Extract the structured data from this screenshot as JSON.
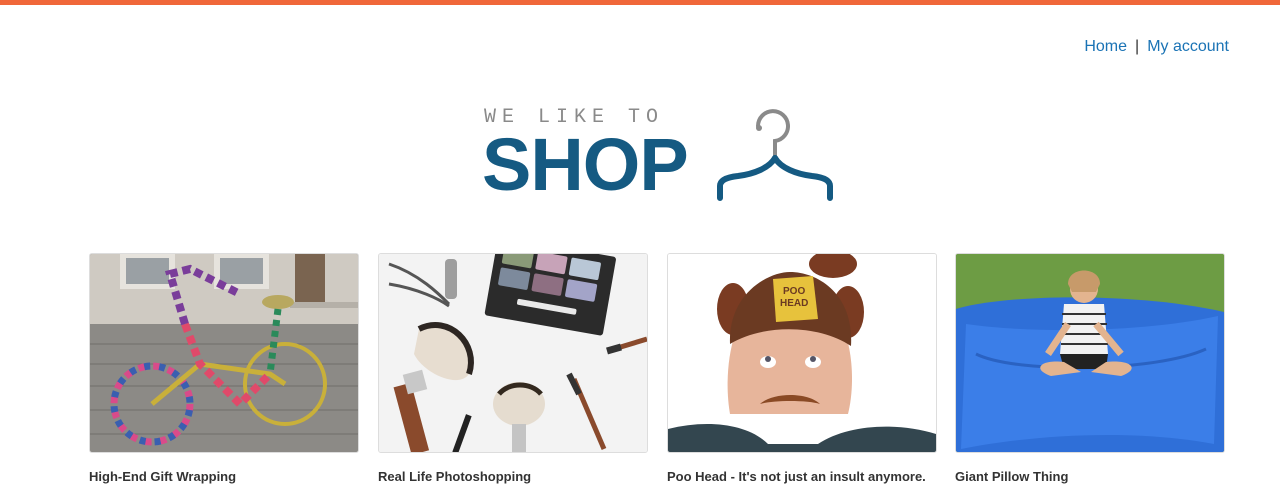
{
  "header": {
    "accent_color": "#f0673a",
    "nav": {
      "home_label": "Home",
      "separator": "|",
      "account_label": "My account",
      "link_color": "#1a73b5"
    }
  },
  "logo": {
    "tagline": "WE LIKE TO",
    "word": "SHOP",
    "icon": "hanger-icon",
    "color": "#155a82"
  },
  "products": [
    {
      "title": "High-End Gift Wrapping",
      "image": "knitted-bicycle-image"
    },
    {
      "title": "Real Life Photoshopping",
      "image": "makeup-brushes-image"
    },
    {
      "title": "Poo Head - It's not just an insult anymore.",
      "image": "poo-head-hat-image"
    },
    {
      "title": "Giant Pillow Thing",
      "image": "giant-pillow-image"
    }
  ]
}
